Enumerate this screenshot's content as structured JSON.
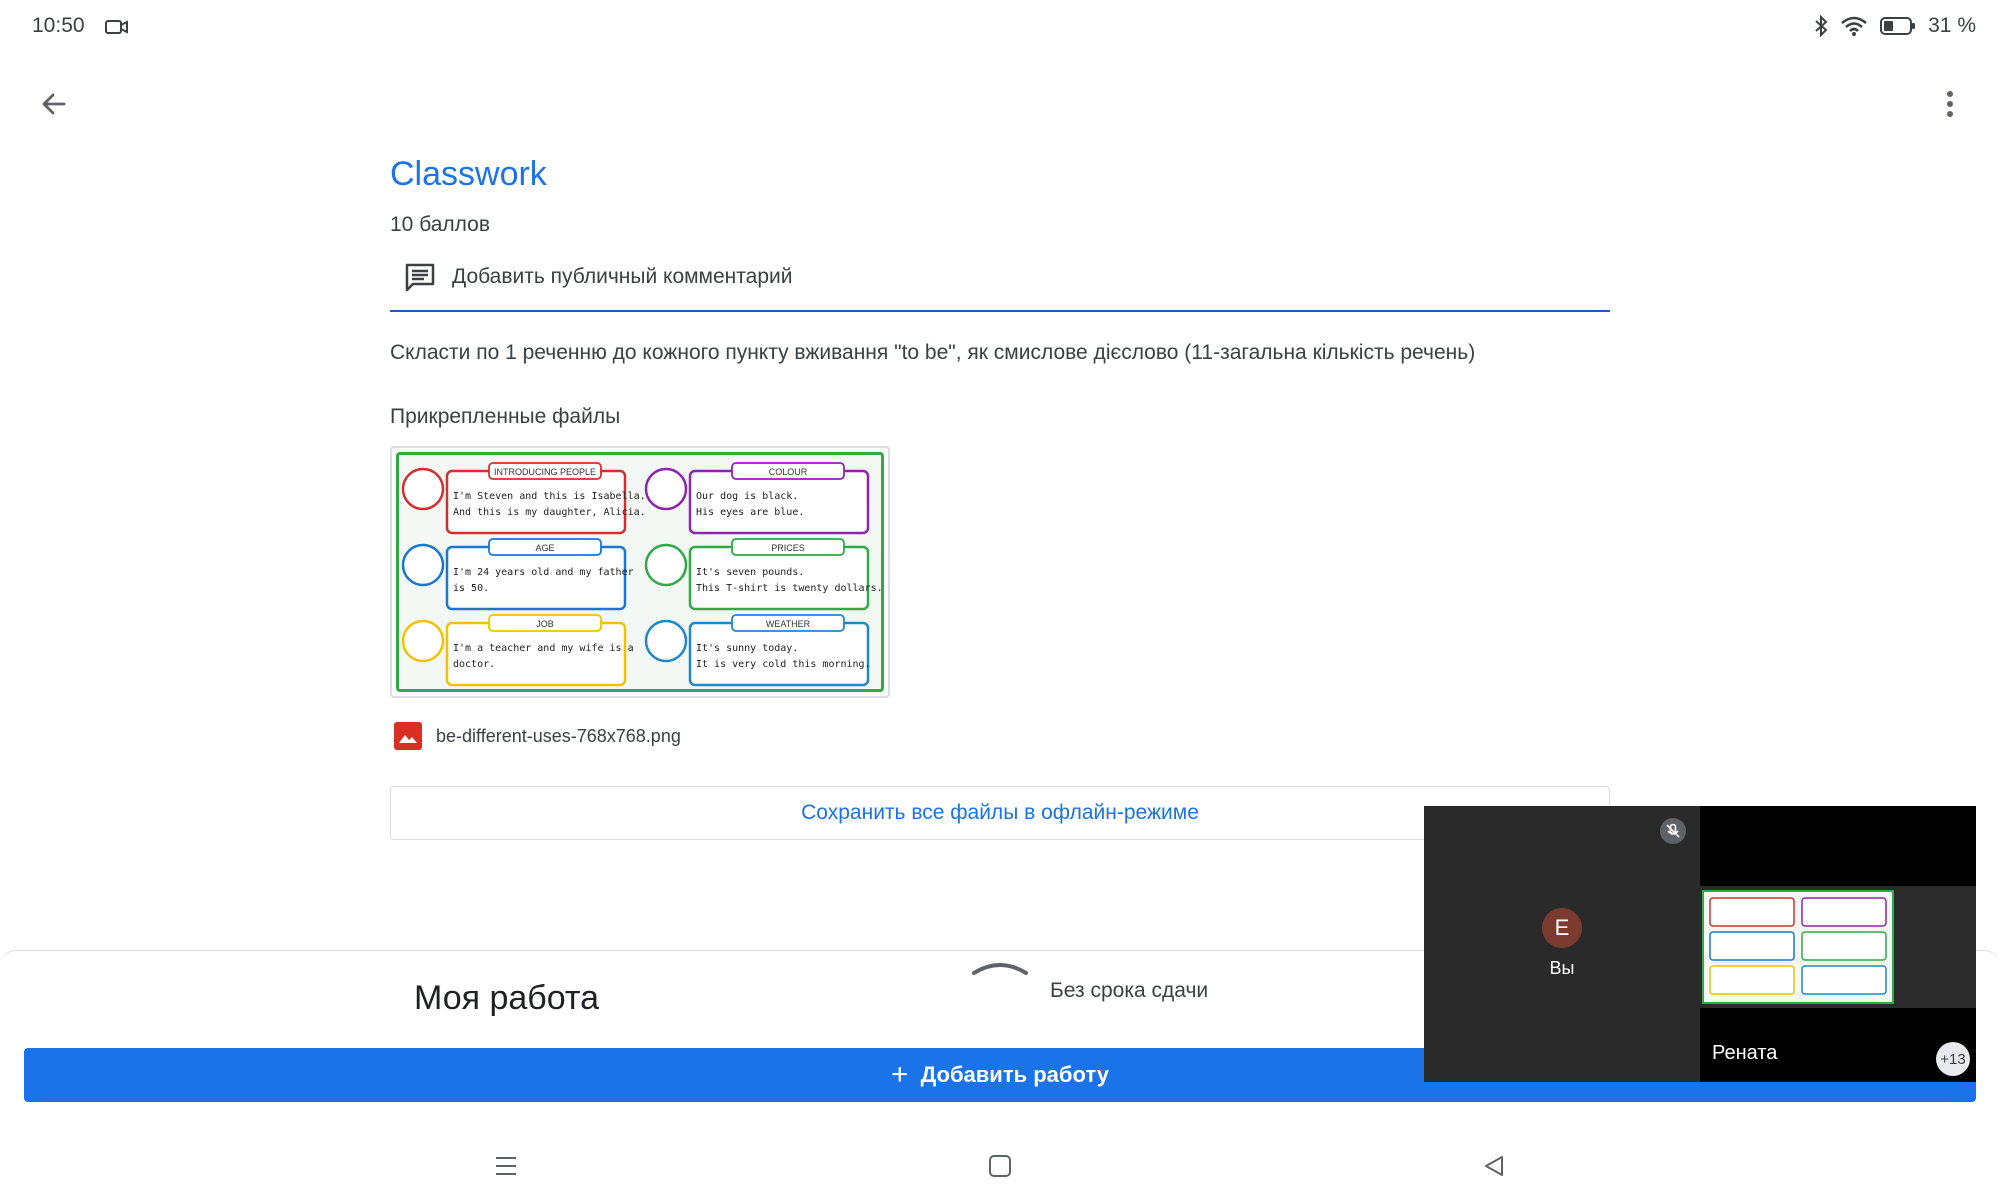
{
  "status_bar": {
    "time": "10:50",
    "battery": "31 %"
  },
  "assignment": {
    "title": "Classwork",
    "points": "10 баллов",
    "comment_label": "Добавить публичный комментарий",
    "instructions": "Скласти по 1 реченню до кожного пункту вживання \"to be\", як смислове дієслово (11-загальна кількість речень)",
    "attachments_heading": "Прикрепленные файлы",
    "file_name": "be-different-uses-768x768.png",
    "save_offline_label": "Сохранить все файлы в офлайн-режиме"
  },
  "thumbnail": {
    "cards": [
      {
        "heading": "INTRODUCING PEOPLE",
        "line1": "I'm Steven and this is Isabella.",
        "line2": "And this is my daughter, Alicia.",
        "color": "#d32f2f"
      },
      {
        "heading": "COLOUR",
        "line1": "Our dog is black.",
        "line2": "His eyes are blue.",
        "color": "#8e24aa"
      },
      {
        "heading": "AGE",
        "line1": "I'm 24 years old and my father",
        "line2": "is 50.",
        "color": "#1976d2"
      },
      {
        "heading": "PRICES",
        "line1": "It's seven pounds.",
        "line2": "This T-shirt is twenty dollars.",
        "color": "#2eaa47"
      },
      {
        "heading": "JOB",
        "line1": "I'm a teacher and my wife is a",
        "line2": "doctor.",
        "color": "#f2c200"
      },
      {
        "heading": "WEATHER",
        "line1": "It's sunny today.",
        "line2": "It is very cold this morning.",
        "color": "#1e88c9"
      }
    ]
  },
  "my_work": {
    "title": "Моя работа",
    "deadline": "Без срока сдачи",
    "add_label": "Добавить работу"
  },
  "meet": {
    "self_initial": "Е",
    "self_label": "Вы",
    "remote_name": "Рената",
    "extra_count": "+13"
  },
  "colors": {
    "accent": "#1a73e8",
    "divider": "#1a5fb4",
    "file_icon": "#d93025"
  }
}
